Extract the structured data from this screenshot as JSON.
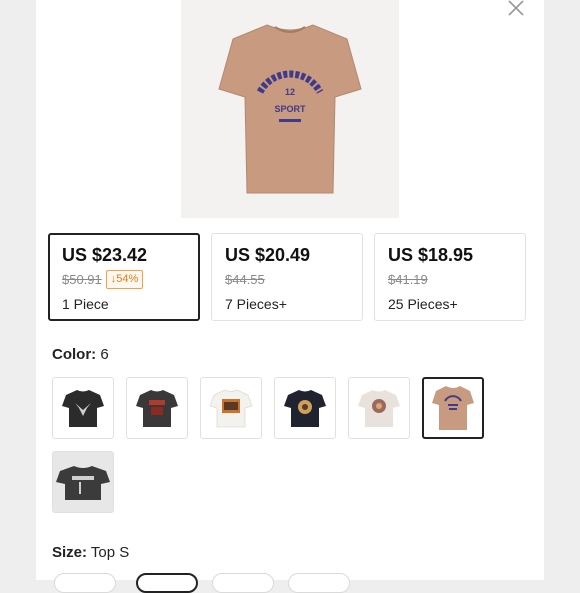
{
  "product": {
    "image_icon": "tshirt-product-image"
  },
  "close": {
    "icon": "close-icon"
  },
  "tiers": [
    {
      "price": "US $23.42",
      "original": "$50.91",
      "discount": "54%",
      "qty": "1 Piece",
      "selected": true
    },
    {
      "price": "US $20.49",
      "original": "$44.55",
      "qty": "7 Pieces+",
      "selected": false
    },
    {
      "price": "US $18.95",
      "original": "$41.19",
      "qty": "25 Pieces+",
      "selected": false
    }
  ],
  "color": {
    "label": "Color:",
    "value": "6",
    "selected_index": 5
  },
  "colors": [
    {
      "name": "black-eagle-print",
      "base": "#2b2b2b",
      "print": "#cfcfcf"
    },
    {
      "name": "charcoal-red-print",
      "base": "#3a3838",
      "print": "#b23a2c"
    },
    {
      "name": "white-tiger-print",
      "base": "#f4f2ee",
      "print": "#c8742e"
    },
    {
      "name": "navy-tiger-print",
      "base": "#1f2330",
      "print": "#d0a05a"
    },
    {
      "name": "light-pink-print",
      "base": "#e9e1dc",
      "print": "#9a6a5c"
    },
    {
      "name": "tan-sport-print",
      "base": "#c89a80",
      "print": "#3f3a8a"
    },
    {
      "name": "dark-grey-logo",
      "base": "#3b3b3b",
      "print": "#cfcfcf"
    }
  ],
  "size": {
    "label": "Size:",
    "value": "Top S"
  },
  "colors_accent": {
    "price": "#111111",
    "discount_border": "#f0a24a",
    "discount_text": "#e07b14"
  }
}
